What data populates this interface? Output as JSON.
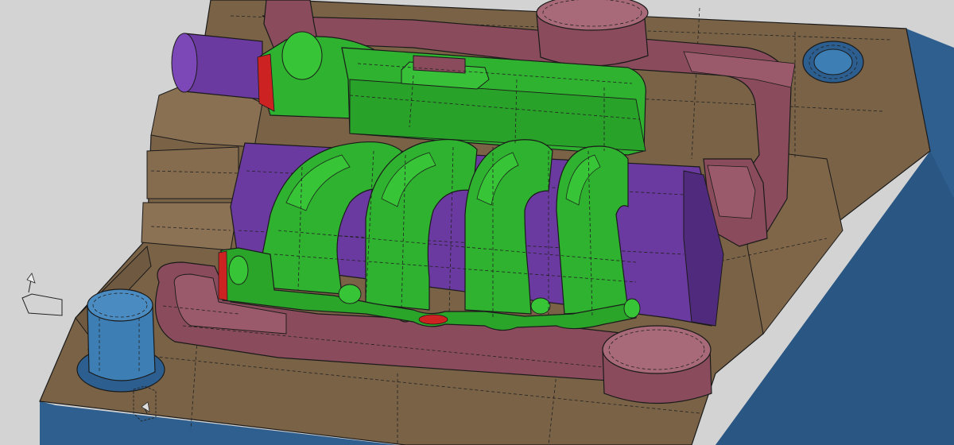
{
  "colors": {
    "background": "#d3d3d3",
    "mold_base": "#7a6246",
    "mold_side": "#2e5f8f",
    "insert": "#8a4c5d",
    "slide_core": "#6a3aa0",
    "part": "#2fb22f",
    "guide_pillar": "#3d7fb5",
    "gate_marker": "#cc2222"
  },
  "icons": {
    "triad": "coordinate-triad-icon",
    "triad_small": "coordinate-triad-small-icon"
  }
}
